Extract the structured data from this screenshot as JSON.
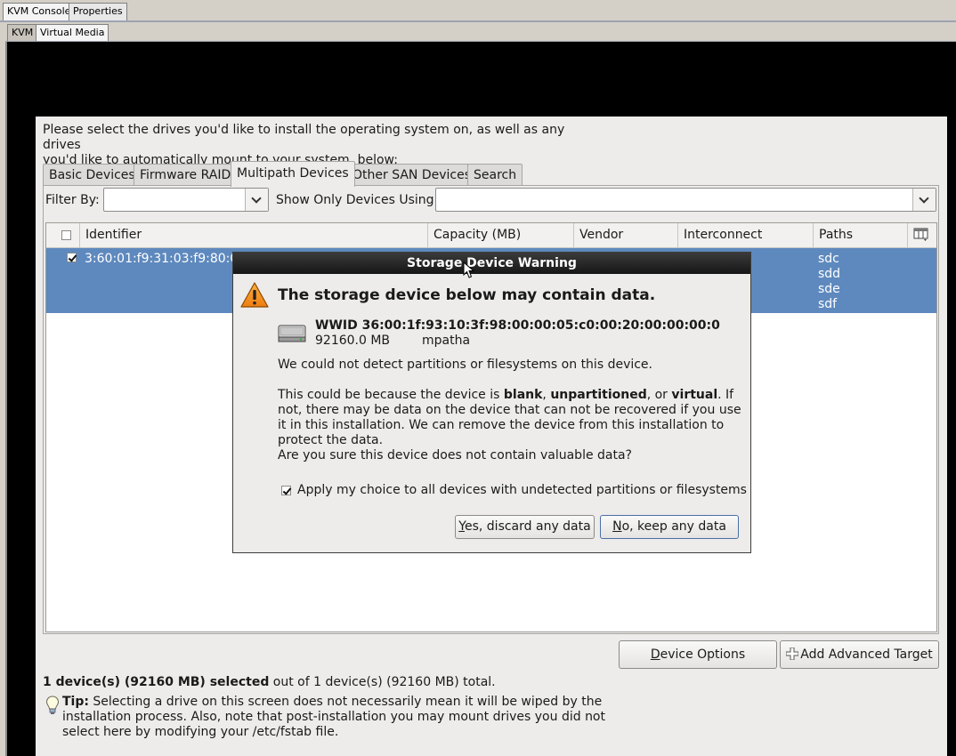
{
  "kvm": {
    "outer_tabs": [
      "KVM Console",
      "Properties"
    ],
    "inner_tabs": [
      "KVM",
      "Virtual Media"
    ]
  },
  "installer": {
    "intro_line1": "Please select the drives you'd like to install the operating system on, as well as any drives",
    "intro_line2": "you'd like to automatically mount to your system, below:",
    "tabs": [
      "Basic Devices",
      "Firmware RAID",
      "Multipath Devices",
      "Other SAN Devices",
      "Search"
    ],
    "active_tab": "Multipath Devices",
    "filter_label": "Filter By:",
    "filter_value": "",
    "show_only_label": "Show Only Devices Using:",
    "show_only_value": "",
    "table": {
      "columns": [
        "Identifier",
        "Capacity (MB)",
        "Vendor",
        "Interconnect",
        "Paths"
      ],
      "rows": [
        {
          "checked": true,
          "identifier": "3:60:01:f9:31:03:f9:80:00",
          "paths": [
            "sdc",
            "sdd",
            "sde",
            "sdf"
          ]
        }
      ]
    },
    "device_options_label": "Device Options",
    "device_options_mnemonic": "D",
    "device_options_rest": "evice Options",
    "add_target_label": "Add Advanced Target",
    "summary_bold": "1 device(s) (92160 MB) selected",
    "summary_rest": " out of 1 device(s) (92160 MB) total.",
    "tip_bold": "Tip:",
    "tip_text": " Selecting a drive on this screen does not necessarily mean it will be wiped by the installation process.  Also, note that post-installation you may mount drives you did not select here by modifying your /etc/fstab file."
  },
  "dialog": {
    "title": "Storage Device Warning",
    "heading": "The storage device below may contain data.",
    "wwid": "WWID 36:00:1f:93:10:3f:98:00:00:05:c0:00:20:00:00:00:0",
    "size": "92160.0 MB",
    "name": "mpatha",
    "p1": "We could not detect partitions or filesystems on this device.",
    "p2_a": "This could be because the device is ",
    "p2_b1": "blank",
    "p2_c": ", ",
    "p2_b2": "unpartitioned",
    "p2_d": ", or ",
    "p2_b3": "virtual",
    "p2_e": ". If not, there may be data on the device that can not be recovered if you use it in this installation. We can remove the device from this installation to protect the data.",
    "p3": "Are you sure this device does not contain valuable data?",
    "apply_checked": true,
    "apply_label": "Apply my choice to all devices with undetected partitions or filesystems",
    "yes_mnemonic": "Y",
    "yes_rest": "es, discard any data",
    "no_mnemonic": "N",
    "no_rest": "o, keep any data"
  },
  "colors": {
    "selection": "#5e89be",
    "title_bar": "#1e1e1e",
    "window_bg": "#edeceb"
  }
}
